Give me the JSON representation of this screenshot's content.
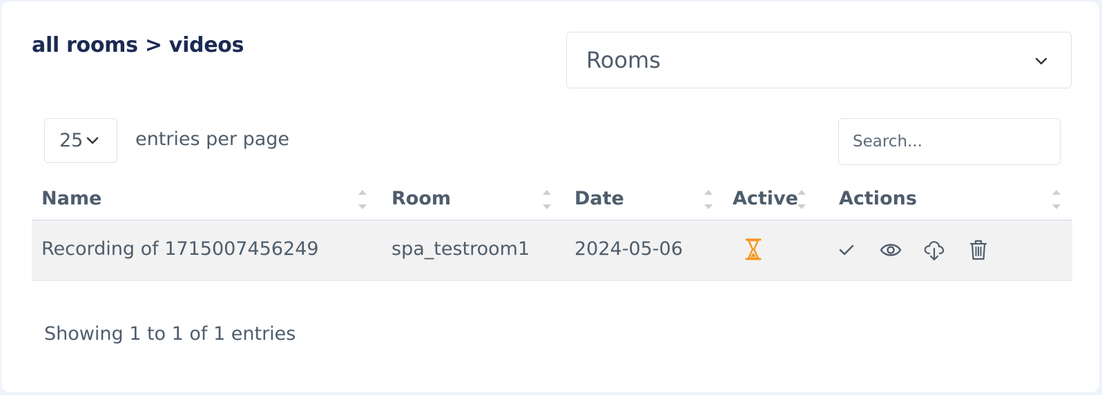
{
  "breadcrumb": "all rooms > videos",
  "room_filter": {
    "selected": "Rooms"
  },
  "pagination": {
    "per_page_value": "25",
    "per_page_label": "entries per page",
    "info": "Showing 1 to 1 of 1 entries"
  },
  "search": {
    "placeholder": "Search...",
    "value": ""
  },
  "table": {
    "columns": [
      "Name",
      "Room",
      "Date",
      "Active",
      "Actions"
    ],
    "rows": [
      {
        "name": "Recording of 1715007456249",
        "room": "spa_testroom1",
        "date": "2024-05-06",
        "active_icon": "hourglass-icon",
        "actions": [
          "check-icon",
          "eye-icon",
          "cloud-download-icon",
          "trash-icon"
        ]
      }
    ]
  },
  "colors": {
    "heading": "#1b2a52",
    "text": "#4e5d6c",
    "pending": "#f7941d",
    "row_bg": "#f2f2f2"
  }
}
